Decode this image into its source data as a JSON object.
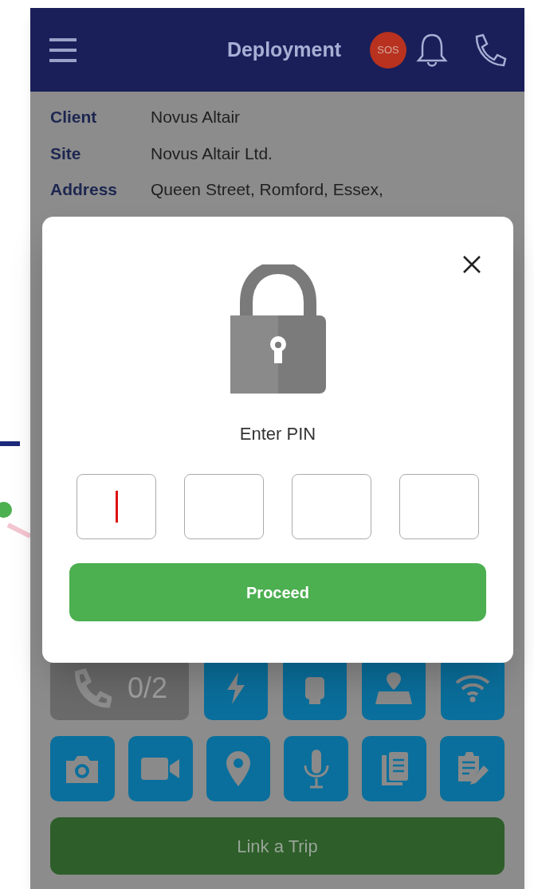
{
  "header": {
    "title": "Deployment",
    "sos_badge": "SOS"
  },
  "details": [
    {
      "label": "Client",
      "value": "Novus Altair"
    },
    {
      "label": "Site",
      "value": "Novus Altair Ltd."
    },
    {
      "label": "Address",
      "value": "Queen Street, Romford, Essex,"
    }
  ],
  "call_counter": "0/2",
  "pin_dialog": {
    "prompt": "Enter PIN",
    "pin_boxes": [
      {
        "focused": true
      },
      {
        "focused": false
      },
      {
        "focused": false
      },
      {
        "focused": false
      }
    ],
    "proceed_button": "Proceed"
  },
  "link_trip_button": "Link a Trip"
}
